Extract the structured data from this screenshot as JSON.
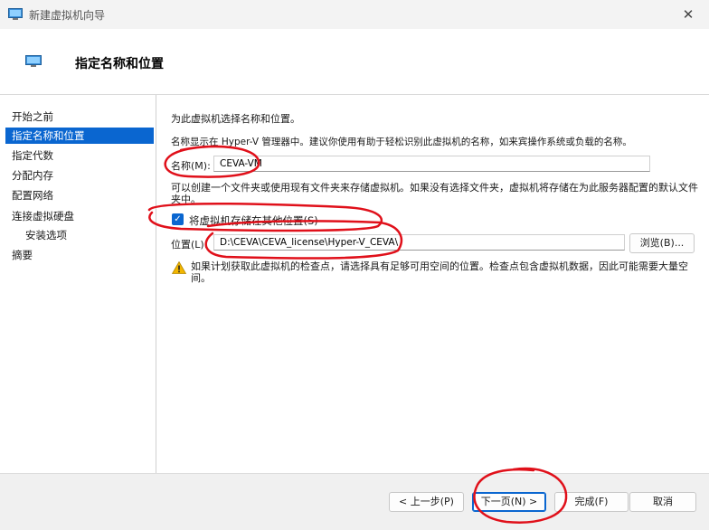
{
  "window": {
    "title": "新建虚拟机向导",
    "icons": {
      "app": "hyper-v-monitor-icon",
      "close": "close-icon"
    }
  },
  "header": {
    "title": "指定名称和位置"
  },
  "sidebar": {
    "items": [
      {
        "label": "开始之前",
        "active": false
      },
      {
        "label": "指定名称和位置",
        "active": true
      },
      {
        "label": "指定代数",
        "active": false
      },
      {
        "label": "分配内存",
        "active": false
      },
      {
        "label": "配置网络",
        "active": false
      },
      {
        "label": "连接虚拟硬盘",
        "active": false
      },
      {
        "label": "安装选项",
        "active": false,
        "sub": true
      },
      {
        "label": "摘要",
        "active": false
      }
    ]
  },
  "main": {
    "intro": "为此虚拟机选择名称和位置。",
    "name_desc": "名称显示在 Hyper-V 管理器中。建议你使用有助于轻松识别此虚拟机的名称，如来宾操作系统或负载的名称。",
    "name_label": "名称(M):",
    "name_value": "CEVA-VM",
    "folder_desc": "可以创建一个文件夹或使用现有文件夹来存储虚拟机。如果没有选择文件夹，虚拟机将存储在为此服务器配置的默认文件夹中。",
    "store_checkbox": {
      "label": "将虚拟机存储在其他位置(S)",
      "checked": true
    },
    "location_label": "位置(L):",
    "location_value": "D:\\CEVA\\CEVA_license\\Hyper-V_CEVA\\",
    "browse_label": "浏览(B)...",
    "warning": "如果计划获取此虚拟机的检查点，请选择具有足够可用空间的位置。检查点包含虚拟机数据，因此可能需要大量空间。",
    "warning_icon": "warning-icon"
  },
  "footer": {
    "prev": "< 上一步(P)",
    "next": "下一页(N) >",
    "finish": "完成(F)",
    "cancel": "取消"
  },
  "colors": {
    "accent": "#0a66d0",
    "annotation": "#e0101a",
    "warning": "#f2b600"
  }
}
